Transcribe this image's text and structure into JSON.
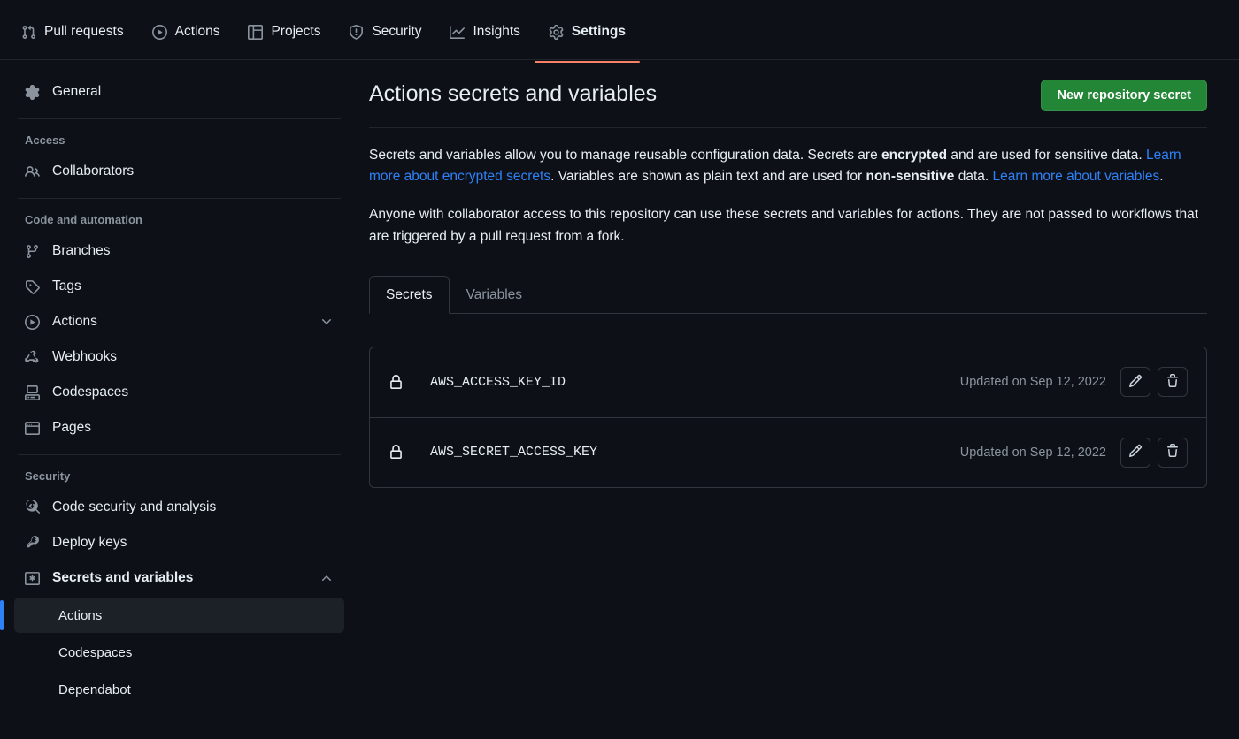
{
  "topnav": {
    "items": [
      {
        "label": "Pull requests",
        "icon": "git-pull-request-icon",
        "active": false
      },
      {
        "label": "Actions",
        "icon": "play-circle-icon",
        "active": false
      },
      {
        "label": "Projects",
        "icon": "table-icon",
        "active": false
      },
      {
        "label": "Security",
        "icon": "shield-icon",
        "active": false
      },
      {
        "label": "Insights",
        "icon": "graph-icon",
        "active": false
      },
      {
        "label": "Settings",
        "icon": "gear-icon",
        "active": true
      }
    ]
  },
  "sidebar": {
    "general": {
      "label": "General",
      "icon": "gear-icon"
    },
    "access_title": "Access",
    "collaborators": {
      "label": "Collaborators",
      "icon": "people-icon"
    },
    "code_automation_title": "Code and automation",
    "code_items": [
      {
        "label": "Branches",
        "icon": "git-branch-icon"
      },
      {
        "label": "Tags",
        "icon": "tag-icon"
      },
      {
        "label": "Actions",
        "icon": "play-circle-icon",
        "chevron": "chevron-down"
      },
      {
        "label": "Webhooks",
        "icon": "webhook-icon"
      },
      {
        "label": "Codespaces",
        "icon": "codespaces-icon"
      },
      {
        "label": "Pages",
        "icon": "browser-icon"
      }
    ],
    "security_title": "Security",
    "security_items": [
      {
        "label": "Code security and analysis",
        "icon": "codescan-icon"
      },
      {
        "label": "Deploy keys",
        "icon": "key-icon"
      },
      {
        "label": "Secrets and variables",
        "icon": "key-asterisk-icon",
        "chevron": "chevron-up",
        "bold": true
      }
    ],
    "secrets_subitems": [
      {
        "label": "Actions",
        "selected": true
      },
      {
        "label": "Codespaces",
        "selected": false
      },
      {
        "label": "Dependabot",
        "selected": false
      }
    ]
  },
  "main": {
    "title": "Actions secrets and variables",
    "new_secret_button": "New repository secret",
    "paragraph1": {
      "t1": "Secrets and variables allow you to manage reusable configuration data. Secrets are ",
      "b1": "encrypted",
      "t2": " and are used for sensitive data. ",
      "link1": "Learn more about encrypted secrets",
      "t3": ". Variables are shown as plain text and are used for ",
      "b2": "non-sensitive",
      "t4": " data. ",
      "link2": "Learn more about variables",
      "t5": "."
    },
    "paragraph2": "Anyone with collaborator access to this repository can use these secrets and variables for actions. They are not passed to workflows that are triggered by a pull request from a fork.",
    "tabs": [
      {
        "label": "Secrets",
        "active": true
      },
      {
        "label": "Variables",
        "active": false
      }
    ],
    "secrets": [
      {
        "name": "AWS_ACCESS_KEY_ID",
        "updated": "Updated on Sep 12, 2022",
        "edit": "edit-icon",
        "delete": "trash-icon"
      },
      {
        "name": "AWS_SECRET_ACCESS_KEY",
        "updated": "Updated on Sep 12, 2022",
        "edit": "edit-icon",
        "delete": "trash-icon"
      }
    ]
  },
  "colors": {
    "background": "#0d1117",
    "accent_blue": "#2f81f7",
    "green_button": "#238636",
    "active_tab_underline": "#f78166",
    "border": "#30363d",
    "muted_text": "#8b949e"
  }
}
